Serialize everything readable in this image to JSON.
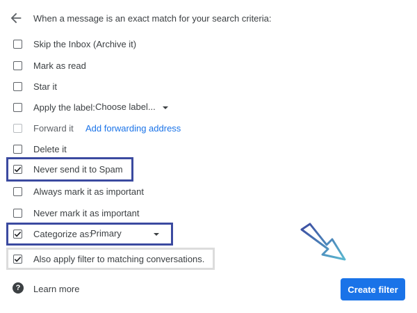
{
  "header": {
    "back_icon": "arrow-left-icon",
    "title": "When a message is an exact match for your search criteria:"
  },
  "options": [
    {
      "label": "Skip the Inbox (Archive it)",
      "checked": false
    },
    {
      "label": "Mark as read",
      "checked": false
    },
    {
      "label": "Star it",
      "checked": false
    },
    {
      "label": "Apply the label:",
      "checked": false,
      "select_value": "Choose label..."
    },
    {
      "label": "Forward it",
      "checked": false,
      "disabled": true,
      "link": "Add forwarding address"
    },
    {
      "label": "Delete it",
      "checked": false
    },
    {
      "label": "Never send it to Spam",
      "checked": true
    },
    {
      "label": "Always mark it as important",
      "checked": false
    },
    {
      "label": "Never mark it as important",
      "checked": false
    },
    {
      "label": "Categorize as:",
      "checked": true,
      "select_value": "Primary"
    },
    {
      "label": "Also apply filter to matching conversations.",
      "checked": true
    }
  ],
  "footer": {
    "help_icon": "help-circle-icon",
    "learn_more": "Learn more",
    "create_button": "Create filter"
  },
  "colors": {
    "accent": "#1a73e8",
    "highlight_border": "#3b4aa0",
    "secondary_highlight": "#dcdcdc"
  },
  "annotation": {
    "icon": "pointing-arrow-icon"
  }
}
